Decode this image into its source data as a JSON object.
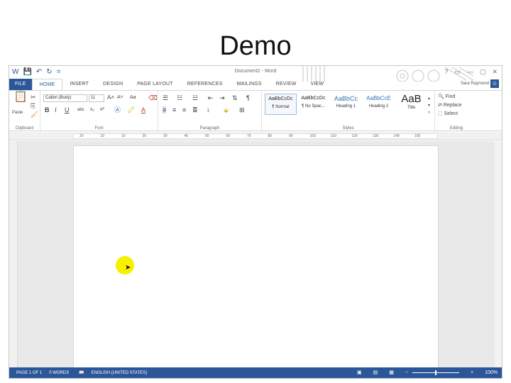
{
  "slide": {
    "title": "Demo"
  },
  "window": {
    "doc_title": "Document2 - Word",
    "user_name": "Sara Raymond",
    "controls": [
      "?",
      "▭",
      "—",
      "▢",
      "✕"
    ]
  },
  "qat": {
    "save": "💾",
    "undo": "↶",
    "redo": "↻",
    "customize": "="
  },
  "tabs": [
    {
      "label": "FILE"
    },
    {
      "label": "HOME"
    },
    {
      "label": "INSERT"
    },
    {
      "label": "DESIGN"
    },
    {
      "label": "PAGE LAYOUT"
    },
    {
      "label": "REFERENCES"
    },
    {
      "label": "MAILINGS"
    },
    {
      "label": "REVIEW"
    },
    {
      "label": "VIEW"
    }
  ],
  "ribbon": {
    "clipboard": {
      "label": "Clipboard",
      "paste": "Paste"
    },
    "font": {
      "label": "Font",
      "family": "Calibri (Body)",
      "size": "11",
      "bold": "B",
      "italic": "I",
      "underline": "U"
    },
    "paragraph": {
      "label": "Paragraph"
    },
    "styles": {
      "label": "Styles",
      "items": [
        {
          "sample": "AaBbCcDc",
          "name": "¶ Normal"
        },
        {
          "sample": "AaBbCcDc",
          "name": "¶ No Spac..."
        },
        {
          "sample": "AaBbCc",
          "name": "Heading 1"
        },
        {
          "sample": "AaBbCcE",
          "name": "Heading 2"
        },
        {
          "sample": "AaB",
          "name": "Title"
        }
      ]
    },
    "editing": {
      "label": "Editing",
      "find": "Find",
      "replace": "Replace",
      "select": "Select"
    }
  },
  "ruler": {
    "numbers": [
      "20",
      "10",
      "10",
      "20",
      "30",
      "40",
      "50",
      "60",
      "70",
      "80",
      "90",
      "100",
      "110",
      "120",
      "130",
      "140",
      "150"
    ]
  },
  "statusbar": {
    "page": "PAGE 1 OF 1",
    "words": "0 WORDS",
    "language": "ENGLISH (UNITED STATES)",
    "zoom": "100%",
    "zoom_minus": "−",
    "zoom_plus": "+"
  }
}
